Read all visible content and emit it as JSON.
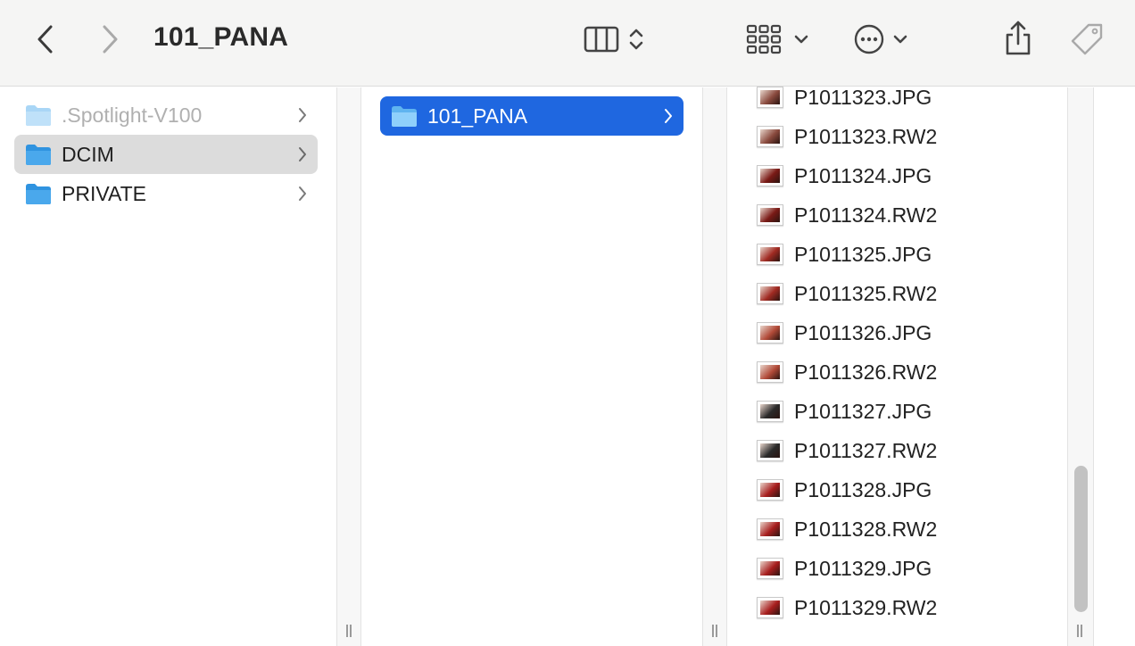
{
  "window": {
    "title": "101_PANA"
  },
  "toolbar": {
    "back_icon": "chevron-left-icon",
    "forward_icon": "chevron-right-icon",
    "view_icon": "columns-view-icon",
    "group_icon": "grid-group-icon",
    "more_icon": "ellipsis-circle-icon",
    "share_icon": "share-icon",
    "tag_icon": "tag-icon"
  },
  "column1": {
    "items": [
      {
        "label": ".Spotlight-V100",
        "state": "dim"
      },
      {
        "label": "DCIM",
        "state": "selected"
      },
      {
        "label": "PRIVATE",
        "state": "normal"
      }
    ]
  },
  "column2": {
    "items": [
      {
        "label": "101_PANA",
        "state": "selected"
      }
    ]
  },
  "column3": {
    "files": [
      {
        "name": "P1011323.JPG",
        "thumb": "#8a4a3e"
      },
      {
        "name": "P1011323.RW2",
        "thumb": "#8a4a3e"
      },
      {
        "name": "P1011324.JPG",
        "thumb": "#7a1a16"
      },
      {
        "name": "P1011324.RW2",
        "thumb": "#7a1a16"
      },
      {
        "name": "P1011325.JPG",
        "thumb": "#a02a22"
      },
      {
        "name": "P1011325.RW2",
        "thumb": "#a02a22"
      },
      {
        "name": "P1011326.JPG",
        "thumb": "#b24a38"
      },
      {
        "name": "P1011326.RW2",
        "thumb": "#b24a38"
      },
      {
        "name": "P1011327.JPG",
        "thumb": "#2a2a2a"
      },
      {
        "name": "P1011327.RW2",
        "thumb": "#2a2a2a"
      },
      {
        "name": "P1011328.JPG",
        "thumb": "#a81e1e"
      },
      {
        "name": "P1011328.RW2",
        "thumb": "#a81e1e"
      },
      {
        "name": "P1011329.JPG",
        "thumb": "#a81e1e"
      },
      {
        "name": "P1011329.RW2",
        "thumb": "#a81e1e"
      }
    ]
  },
  "colors": {
    "accent": "#1f67e0",
    "folder": "#4aa8ec",
    "selection_gray": "#dcdcdc"
  }
}
